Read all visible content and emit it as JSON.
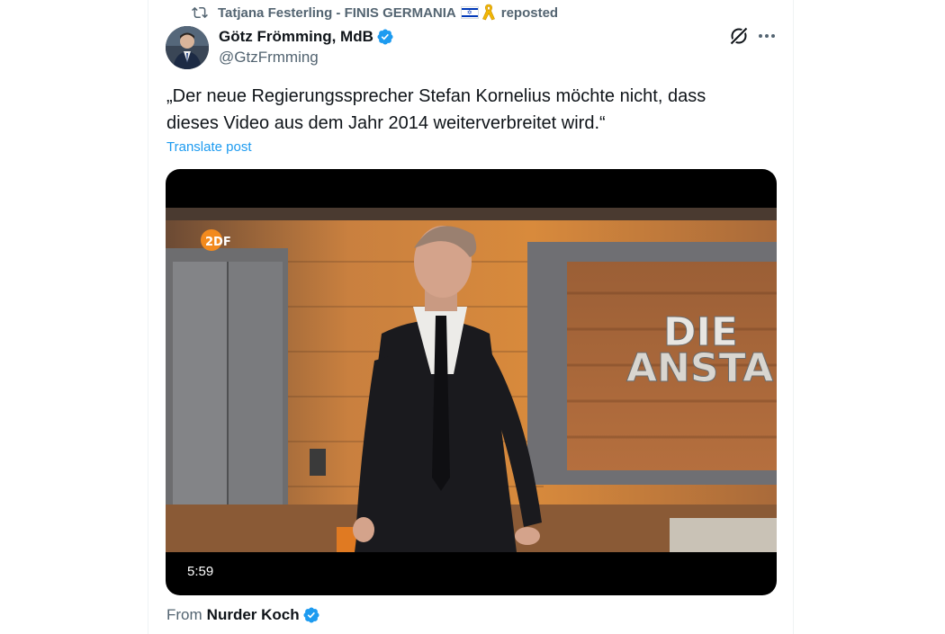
{
  "repost": {
    "icon": "repost-icon",
    "user": "Tatjana Festerling - FINIS GERMANIA",
    "flag_icon": "israel-flag-icon",
    "ribbon_icon": "yellow-ribbon-icon",
    "action": "reposted"
  },
  "author": {
    "name": "Götz Frömming, MdB",
    "handle": "@GtzFrmming",
    "verified": true,
    "verified_color": "#1d9bf0"
  },
  "post": {
    "text": "„Der neue Regierungssprecher Stefan Kornelius möchte nicht, dass dieses Video aus dem Jahr 2014 weiterverbreitet wird.“",
    "translate_label": "Translate post"
  },
  "video": {
    "duration": "5:59",
    "channel_logo": "2DF",
    "set_text_line1": "DIE",
    "set_text_line2": "ANSTA"
  },
  "source": {
    "from_label": "From",
    "name": "Nurder Koch",
    "verified": true
  },
  "colors": {
    "text_primary": "#0f1419",
    "text_secondary": "#536471",
    "link": "#1d9bf0"
  }
}
